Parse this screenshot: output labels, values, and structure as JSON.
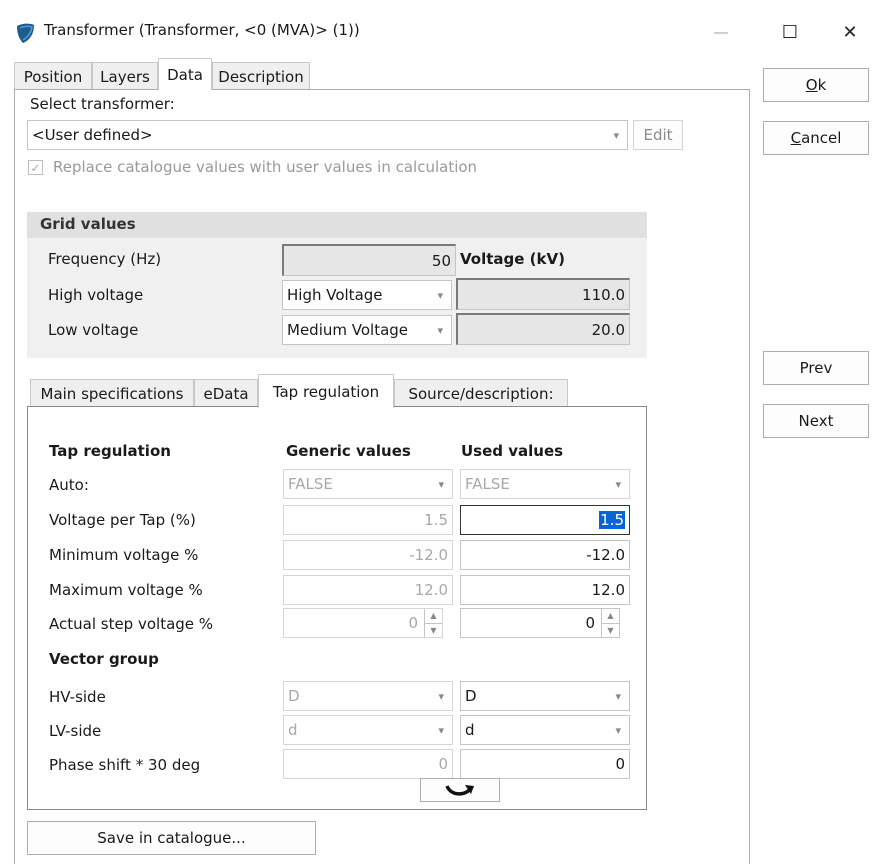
{
  "window": {
    "title": "Transformer   (Transformer, <0 (MVA)> (1))",
    "min_glyph": "—",
    "max_glyph": "☐",
    "close_glyph": "✕"
  },
  "tabs": [
    "Position",
    "Layers",
    "Data",
    "Description"
  ],
  "active_tab": "Data",
  "buttons": {
    "ok_prefix": "",
    "ok_u": "O",
    "ok_rest": "k",
    "cancel_u": "C",
    "cancel_rest": "ancel",
    "prev": "Prev",
    "next": "Next",
    "edit": "Edit",
    "save_catalogue": "Save in catalogue..."
  },
  "select_transformer": {
    "label": "Select transformer:",
    "value": "<User defined>"
  },
  "replace_checkbox": {
    "label": "Replace catalogue values with user values in calculation",
    "checked": true
  },
  "grid_values": {
    "heading": "Grid values",
    "frequency_label": "Frequency (Hz)",
    "frequency_value": "50",
    "voltage_heading": "Voltage (kV)",
    "high_label": "High voltage",
    "high_combo": "High Voltage",
    "high_value": "110.0",
    "low_label": "Low voltage",
    "low_combo": "Medium Voltage",
    "low_value": "20.0"
  },
  "sub_tabs": [
    "Main specifications",
    "eData",
    "Tap regulation",
    "Source/description:"
  ],
  "active_sub_tab": "Tap regulation",
  "tap": {
    "heading": "Tap regulation",
    "generic_heading": "Generic values",
    "used_heading": "Used values",
    "rows": {
      "auto": {
        "label": "Auto:",
        "generic": "FALSE",
        "used": "FALSE"
      },
      "vpt": {
        "label": "Voltage per Tap (%)",
        "generic": "1.5",
        "used": "1.5"
      },
      "min": {
        "label": "Minimum voltage %",
        "generic": "-12.0",
        "used": "-12.0"
      },
      "max": {
        "label": "Maximum voltage %",
        "generic": "12.0",
        "used": "12.0"
      },
      "step": {
        "label": "Actual step voltage %",
        "generic": "0",
        "used": "0"
      }
    },
    "vector_heading": "Vector group",
    "hv": {
      "label": "HV-side",
      "generic": "D",
      "used": "D"
    },
    "lv": {
      "label": "LV-side",
      "generic": "d",
      "used": "d"
    },
    "phase": {
      "label": "Phase shift * 30 deg",
      "generic": "0",
      "used": "0"
    }
  }
}
